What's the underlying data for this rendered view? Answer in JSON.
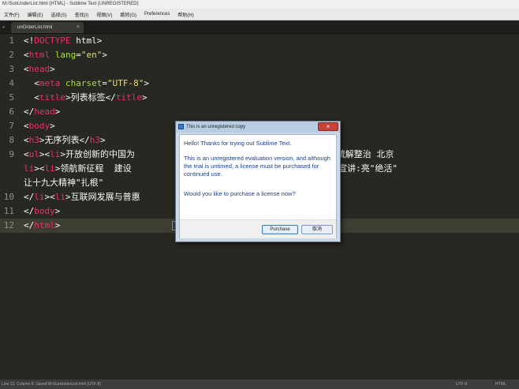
{
  "window": {
    "title": "M:/SunUnderList.html (HTML) - Sublime Text (UNREGISTERED)"
  },
  "menu": [
    "文件(F)",
    "编辑(E)",
    "选择(S)",
    "查找(I)",
    "视图(V)",
    "跳转(G)",
    "Preferences",
    "帮助(H)"
  ],
  "tab": {
    "label": "unOrderList.html",
    "close": "×"
  },
  "code_lines": [
    {
      "num": "1",
      "tokens": [
        [
          "pl",
          "<!"
        ],
        [
          "tg",
          "DOCTYPE"
        ],
        [
          "pl",
          " html>"
        ]
      ]
    },
    {
      "num": "2",
      "tokens": [
        [
          "pl",
          "<"
        ],
        [
          "tg",
          "html"
        ],
        [
          "pl",
          " "
        ],
        [
          "at",
          "lang"
        ],
        [
          "pl",
          "="
        ],
        [
          "st",
          "\"en\""
        ],
        [
          "pl",
          ">"
        ]
      ]
    },
    {
      "num": "3",
      "tokens": [
        [
          "pl",
          "<"
        ],
        [
          "tg",
          "head"
        ],
        [
          "pl",
          ">"
        ]
      ]
    },
    {
      "num": "4",
      "tokens": [
        [
          "pl",
          "  <"
        ],
        [
          "tg",
          "meta"
        ],
        [
          "pl",
          " "
        ],
        [
          "at",
          "charset"
        ],
        [
          "pl",
          "="
        ],
        [
          "st",
          "\"UTF-8\""
        ],
        [
          "pl",
          ">"
        ]
      ]
    },
    {
      "num": "5",
      "tokens": [
        [
          "pl",
          "  <"
        ],
        [
          "tg",
          "title"
        ],
        [
          "pl",
          ">列表标签</"
        ],
        [
          "tg",
          "title"
        ],
        [
          "pl",
          ">"
        ]
      ]
    },
    {
      "num": "6",
      "tokens": [
        [
          "pl",
          "</"
        ],
        [
          "tg",
          "head"
        ],
        [
          "pl",
          ">"
        ]
      ]
    },
    {
      "num": "7",
      "tokens": [
        [
          "pl",
          "<"
        ],
        [
          "tg",
          "body"
        ],
        [
          "pl",
          ">"
        ]
      ]
    },
    {
      "num": "8",
      "tokens": [
        [
          "pl",
          "<"
        ],
        [
          "tg",
          "h3"
        ],
        [
          "pl",
          ">无序列表</"
        ],
        [
          "tg",
          "h3"
        ],
        [
          "pl",
          ">"
        ]
      ]
    },
    {
      "num": "9",
      "tokens": [
        [
          "pl",
          "<"
        ],
        [
          "tg",
          "ul"
        ],
        [
          "pl",
          "><"
        ],
        [
          "tg",
          "li"
        ],
        [
          "pl",
          ">开放创新的中国为                          代新气象新作为 疏解整治 北京"
        ]
      ]
    },
    {
      "num": "",
      "tokens": [
        [
          "tg",
          "li"
        ],
        [
          "pl",
          "><"
        ],
        [
          "tg",
          "li"
        ],
        [
          "pl",
          ">领航新征程  建设                              "
        ],
        [
          "tg",
          "li"
        ],
        [
          "pl",
          ">聚焦基层宣讲:亮\"绝活\""
        ]
      ]
    },
    {
      "num": "",
      "tokens": [
        [
          "pl",
          "让十九大精神\"扎根\""
        ]
      ]
    },
    {
      "num": "10",
      "tokens": [
        [
          "pl",
          "</"
        ],
        [
          "tg",
          "li"
        ],
        [
          "pl",
          "><"
        ],
        [
          "tg",
          "li"
        ],
        [
          "pl",
          ">互联网发展与普惠                            "
        ],
        [
          "tg",
          "li"
        ],
        [
          "pl",
          "></"
        ],
        [
          "tg",
          "ul"
        ],
        [
          "pl",
          ">"
        ]
      ]
    },
    {
      "num": "11",
      "tokens": [
        [
          "pl",
          "</"
        ],
        [
          "tg",
          "body"
        ],
        [
          "pl",
          ">"
        ]
      ]
    },
    {
      "num": "12",
      "tokens": [
        [
          "pl",
          "</"
        ],
        [
          "tg",
          "html"
        ],
        [
          "pl",
          ">"
        ]
      ]
    }
  ],
  "status": {
    "left": "Line 12, Column 8; Saved M:\\SunUnderList.html (UTF-8)",
    "encoding": "UTF-8",
    "syntax": "HTML"
  },
  "dialog": {
    "title": "This is an unregistered copy",
    "close_glyph": "×",
    "msg1": "Hello! Thanks for trying out Sublime Text.",
    "msg2": "This is an unregistered evaluation version, and although the trial is untimed, a license must be purchased for continued use.",
    "msg3": "Would you like to purchase a license now?",
    "purchase": "Purchase",
    "cancel": "取消"
  },
  "colors": {
    "background": "#272822",
    "tag": "#f92672",
    "attr": "#a6e22e",
    "string": "#e6db74"
  }
}
